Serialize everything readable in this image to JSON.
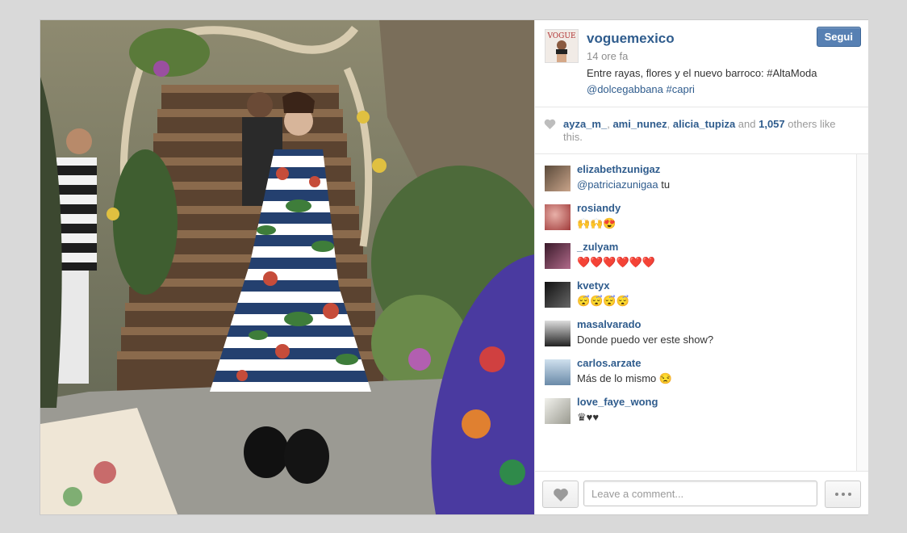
{
  "post": {
    "owner": "voguemexico",
    "time": "14 ore fa",
    "follow_label": "Segui",
    "caption_text": "Entre rayas, flores y el nuevo barroco: #AltaModa",
    "caption_mention": "@dolcegabbana",
    "caption_tag": "#capri",
    "avatar_logo": "VOGUE"
  },
  "likes": {
    "users": [
      "ayza_m_",
      "ami_nunez",
      "alicia_tupiza"
    ],
    "sep1": ", ",
    "sep2": ", ",
    "and_text": " and ",
    "count": "1,057",
    "tail": " others like this."
  },
  "comments": [
    {
      "user": "elizabethzunigaz",
      "mention": "@patriciazunigaa",
      "text": " tu"
    },
    {
      "user": "rosiandy",
      "text": "🙌🙌😍"
    },
    {
      "user": "_zulyam",
      "text": "❤️❤️❤️❤️❤️❤️"
    },
    {
      "user": "kvetyx",
      "text": "😴😴😴😴"
    },
    {
      "user": "masalvarado",
      "text": "Donde puedo ver este show?"
    },
    {
      "user": "carlos.arzate",
      "text": "Más de lo mismo 😒"
    },
    {
      "user": "love_faye_wong",
      "text": "♛♥♥"
    }
  ],
  "footer": {
    "placeholder": "Leave a comment..."
  },
  "colors": {
    "link": "#2f5c8d",
    "follow_button": "#5780b3",
    "background": "#d9d9d9"
  },
  "icons": {
    "like": "heart-icon",
    "more": "ellipsis-icon"
  }
}
